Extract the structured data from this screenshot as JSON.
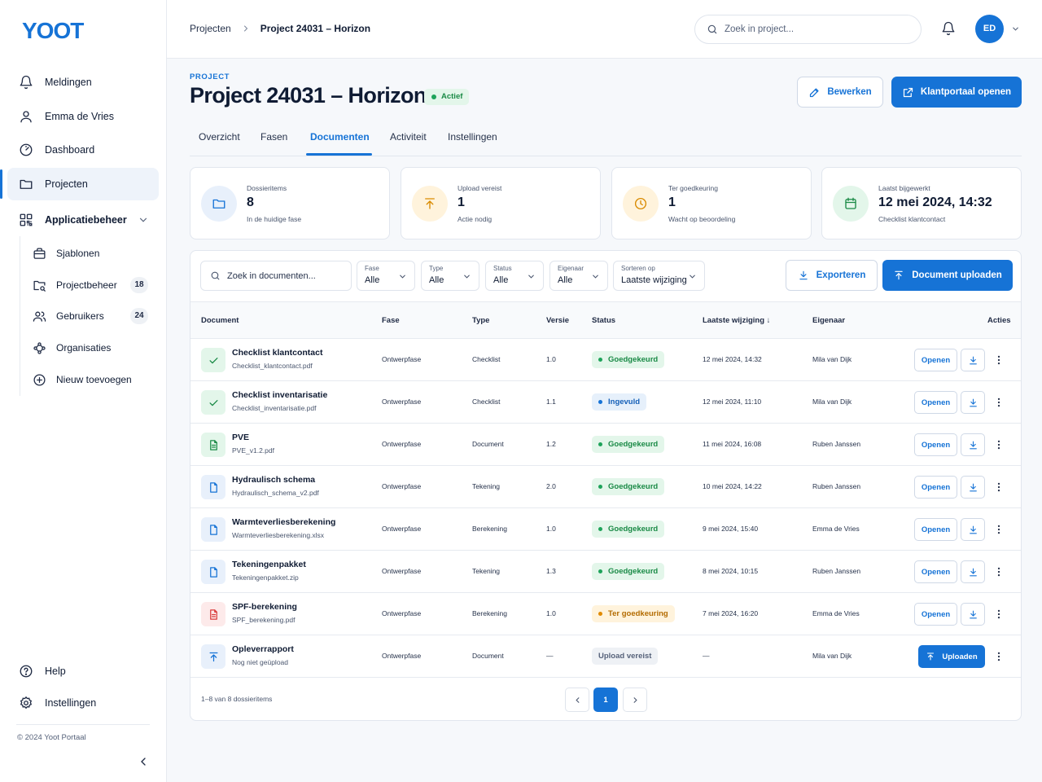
{
  "app": {
    "logo_text": "YOOT",
    "brand_color": "#1673d6"
  },
  "sidebar": {
    "items": [
      {
        "label": "Meldingen",
        "icon": "bell-icon"
      },
      {
        "label": "Emma de Vries",
        "icon": "user-icon"
      },
      {
        "label": "Dashboard",
        "icon": "dashboard-icon"
      },
      {
        "label": "Projecten",
        "icon": "folder-icon",
        "active": true
      },
      {
        "label": "Applicatiebeheer",
        "icon": "apps-icon",
        "expanded": true
      }
    ],
    "subitems": [
      {
        "label": "Sjablonen",
        "icon": "briefcase-icon"
      },
      {
        "label": "Projectbeheer",
        "icon": "folder-search-icon",
        "count": "18"
      },
      {
        "label": "Gebruikers",
        "icon": "users-icon",
        "count": "24"
      },
      {
        "label": "Organisaties",
        "icon": "network-icon"
      },
      {
        "label": "Nieuw toevoegen",
        "icon": "plus-circle-icon"
      }
    ],
    "bottom": [
      {
        "label": "Help",
        "icon": "help-icon"
      },
      {
        "label": "Instellingen",
        "icon": "settings-icon"
      }
    ],
    "copyright": "© 2024 Yoot Portaal"
  },
  "topbar": {
    "breadcrumb": [
      "Projecten",
      "Project 24031 – Horizon"
    ],
    "search_placeholder": "Zoek in project...",
    "avatar_initials": "ED"
  },
  "header": {
    "eyebrow": "PROJECT",
    "title": "Project 24031 – Horizon",
    "status": "Actief",
    "edit_label": "Bewerken",
    "portal_label": "Klantportaal openen"
  },
  "tabs": [
    {
      "label": "Overzicht"
    },
    {
      "label": "Fasen"
    },
    {
      "label": "Documenten",
      "active": true
    },
    {
      "label": "Activiteit"
    },
    {
      "label": "Instellingen"
    }
  ],
  "stats": [
    {
      "label": "Dossieritems",
      "value": "8",
      "sub": "In de huidige fase",
      "icon": "folder-icon"
    },
    {
      "label": "Upload vereist",
      "value": "1",
      "sub": "Actie nodig",
      "icon": "upload-icon"
    },
    {
      "label": "Ter goedkeuring",
      "value": "1",
      "sub": "Wacht op beoordeling",
      "icon": "clock-icon"
    },
    {
      "label": "Laatst bijgewerkt",
      "value": "12 mei 2024, 14:32",
      "sub": "Checklist klantcontact",
      "icon": "calendar-icon"
    }
  ],
  "toolbar": {
    "search_placeholder": "Zoek in documenten...",
    "filters": [
      {
        "label": "Fase",
        "value": "Alle"
      },
      {
        "label": "Type",
        "value": "Alle"
      },
      {
        "label": "Status",
        "value": "Alle"
      },
      {
        "label": "Eigenaar",
        "value": "Alle"
      },
      {
        "label": "Sorteren op",
        "value": "Laatste wijziging"
      }
    ],
    "export_label": "Exporteren",
    "upload_label": "Document uploaden"
  },
  "table": {
    "columns": [
      "Document",
      "Fase",
      "Type",
      "Versie",
      "Status",
      "Laatste wijziging ↓",
      "Eigenaar",
      "Acties"
    ],
    "open_label": "Openen",
    "upload_label": "Uploaden",
    "rows": [
      {
        "name": "Checklist klantcontact",
        "file": "Checklist_klantcontact.pdf",
        "phase": "Ontwerpfase",
        "type": "Checklist",
        "version": "1.0",
        "status": "Goedgekeurd",
        "status_kind": "ok",
        "modified": "12 mei 2024, 14:32",
        "owner": "Mila van Dijk",
        "icon": "check-icon"
      },
      {
        "name": "Checklist inventarisatie",
        "file": "Checklist_inventarisatie.pdf",
        "phase": "Ontwerpfase",
        "type": "Checklist",
        "version": "1.1",
        "status": "Ingevuld",
        "status_kind": "in",
        "modified": "12 mei 2024, 11:10",
        "owner": "Mila van Dijk",
        "icon": "check-icon"
      },
      {
        "name": "PVE",
        "file": "PVE_v1.2.pdf",
        "phase": "Ontwerpfase",
        "type": "Document",
        "version": "1.2",
        "status": "Goedgekeurd",
        "status_kind": "ok",
        "modified": "11 mei 2024, 16:08",
        "owner": "Ruben Janssen",
        "icon": "file-text-icon"
      },
      {
        "name": "Hydraulisch schema",
        "file": "Hydraulisch_schema_v2.pdf",
        "phase": "Ontwerpfase",
        "type": "Tekening",
        "version": "2.0",
        "status": "Goedgekeurd",
        "status_kind": "ok",
        "modified": "10 mei 2024, 14:22",
        "owner": "Ruben Janssen",
        "icon": "file-icon"
      },
      {
        "name": "Warmteverliesberekening",
        "file": "Warmteverliesberekening.xlsx",
        "phase": "Ontwerpfase",
        "type": "Berekening",
        "version": "1.0",
        "status": "Goedgekeurd",
        "status_kind": "ok",
        "modified": "9 mei 2024, 15:40",
        "owner": "Emma de Vries",
        "icon": "file-icon"
      },
      {
        "name": "Tekeningenpakket",
        "file": "Tekeningenpakket.zip",
        "phase": "Ontwerpfase",
        "type": "Tekening",
        "version": "1.3",
        "status": "Goedgekeurd",
        "status_kind": "ok",
        "modified": "8 mei 2024, 10:15",
        "owner": "Ruben Janssen",
        "icon": "file-icon"
      },
      {
        "name": "SPF-berekening",
        "file": "SPF_berekening.pdf",
        "phase": "Ontwerpfase",
        "type": "Berekening",
        "version": "1.0",
        "status": "Ter goedkeuring",
        "status_kind": "wait",
        "modified": "7 mei 2024, 16:20",
        "owner": "Emma de Vries",
        "icon": "file-text-icon"
      },
      {
        "name": "Opleverrapport",
        "file": "Nog niet geüpload",
        "phase": "Ontwerpfase",
        "type": "Document",
        "version": "—",
        "status": "Upload vereist",
        "status_kind": "req",
        "modified": "—",
        "owner": "Mila van Dijk",
        "icon": "upload-icon"
      }
    ]
  },
  "pagination": {
    "info": "1–8 van 8 dossieritems",
    "current": "1"
  }
}
